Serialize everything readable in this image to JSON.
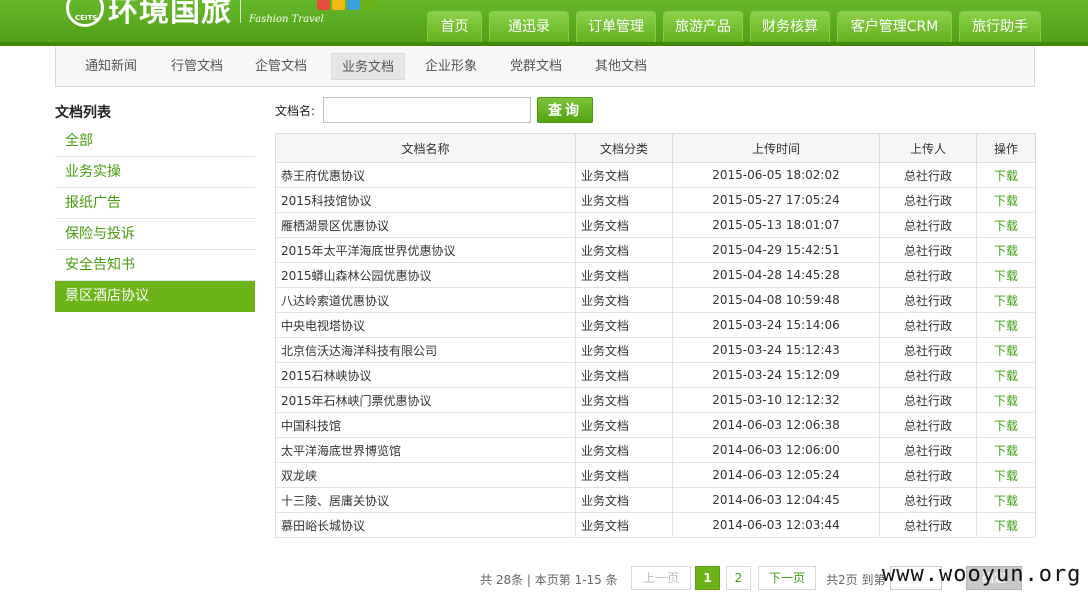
{
  "brand": {
    "name": "环境国旅",
    "badge": "CEITS",
    "tagline": "Fashion Travel",
    "block_colors": [
      "#e84b3c",
      "#f5b915",
      "#3da0e0",
      "#6cb318"
    ]
  },
  "colors": {
    "accent": "#6cb318",
    "link": "#3f9e12"
  },
  "nav": [
    "首页",
    "通迅录",
    "订单管理",
    "旅游产品",
    "财务核算",
    "客户管理CRM",
    "旅行助手"
  ],
  "subnav": {
    "items": [
      "通知新闻",
      "行管文档",
      "企管文档",
      "业务文档",
      "企业形象",
      "党群文档",
      "其他文档"
    ],
    "active": "业务文档"
  },
  "sidebar": {
    "title": "文档列表",
    "items": [
      "全部",
      "业务实操",
      "报纸广告",
      "保险与投诉",
      "安全告知书",
      "景区酒店协议"
    ],
    "active": "景区酒店协议"
  },
  "search": {
    "label": "文档名:",
    "value": "",
    "button": "查询"
  },
  "table": {
    "headers": [
      "文档名称",
      "文档分类",
      "上传时间",
      "上传人",
      "操作"
    ],
    "rows": [
      [
        "恭王府优惠协议",
        "业务文档",
        "2015-06-05 18:02:02",
        "总社行政",
        "下载"
      ],
      [
        "2015科技馆协议",
        "业务文档",
        "2015-05-27 17:05:24",
        "总社行政",
        "下载"
      ],
      [
        "雁栖湖景区优惠协议",
        "业务文档",
        "2015-05-13 18:01:07",
        "总社行政",
        "下载"
      ],
      [
        "2015年太平洋海底世界优惠协议",
        "业务文档",
        "2015-04-29 15:42:51",
        "总社行政",
        "下载"
      ],
      [
        "2015蟒山森林公园优惠协议",
        "业务文档",
        "2015-04-28 14:45:28",
        "总社行政",
        "下载"
      ],
      [
        "八达岭索道优惠协议",
        "业务文档",
        "2015-04-08 10:59:48",
        "总社行政",
        "下载"
      ],
      [
        "中央电视塔协议",
        "业务文档",
        "2015-03-24 15:14:06",
        "总社行政",
        "下载"
      ],
      [
        "北京信沃达海洋科技有限公司",
        "业务文档",
        "2015-03-24 15:12:43",
        "总社行政",
        "下载"
      ],
      [
        "2015石林峡协议",
        "业务文档",
        "2015-03-24 15:12:09",
        "总社行政",
        "下载"
      ],
      [
        "2015年石林峡门票优惠协议",
        "业务文档",
        "2015-03-10 12:12:32",
        "总社行政",
        "下载"
      ],
      [
        "中国科技馆",
        "业务文档",
        "2014-06-03 12:06:38",
        "总社行政",
        "下载"
      ],
      [
        "太平洋海底世界博览馆",
        "业务文档",
        "2014-06-03 12:06:00",
        "总社行政",
        "下载"
      ],
      [
        "双龙峡",
        "业务文档",
        "2014-06-03 12:05:24",
        "总社行政",
        "下载"
      ],
      [
        "十三陵、居庸关协议",
        "业务文档",
        "2014-06-03 12:04:45",
        "总社行政",
        "下载"
      ],
      [
        "慕田峪长城协议",
        "业务文档",
        "2014-06-03 12:03:44",
        "总社行政",
        "下载"
      ]
    ]
  },
  "pager": {
    "summary": "共 28条 | 本页第 1-15 条",
    "prev": "上一页",
    "pages": [
      "1",
      "2"
    ],
    "current": "1",
    "next": "下一页",
    "goto_label": "共2页 到第",
    "goto_value": "",
    "goto_button": "确定"
  },
  "watermark": "www.wooyun.org"
}
